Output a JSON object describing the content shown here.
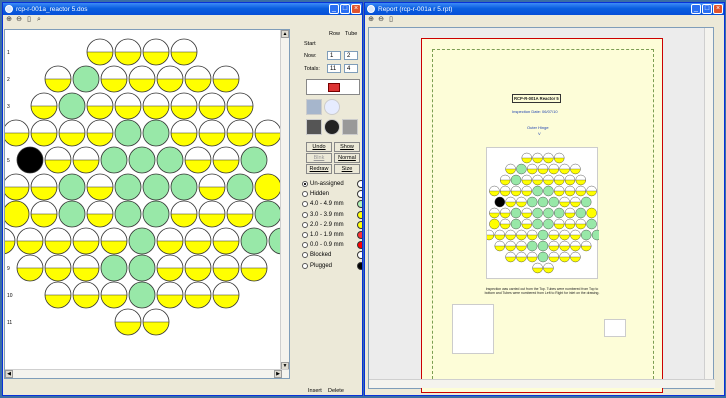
{
  "left_window": {
    "title": "rcp-r-001a_reactor 5.dos",
    "tools": [
      "zoom-in-icon",
      "zoom-out-icon",
      "page-icon",
      "magnify-icon"
    ],
    "controls": {
      "row_header": "Row",
      "tube_header": "Tube",
      "start_label": "Start",
      "now_label": "Now:",
      "now_row": "1",
      "now_tube": "2",
      "totals_label": "Totals:",
      "total_row": "11",
      "total_tube": "4"
    },
    "buttons": {
      "undo": "Undo",
      "blank": "Blnk",
      "show": "Show",
      "normal": "Normal",
      "redraw": "Redraw",
      "size": "Size"
    },
    "legend": [
      {
        "label": "Un-assigned",
        "color": "#ffffff",
        "checked": true
      },
      {
        "label": "Hidden",
        "color": "#ffffff",
        "checked": false
      },
      {
        "label": "4.0 - 4.9 mm",
        "color": "#b0f0b8",
        "checked": false
      },
      {
        "label": "3.0 - 3.9 mm",
        "color": "#ffff00",
        "checked": false
      },
      {
        "label": "2.0 - 2.9 mm",
        "color": "#ffff00",
        "checked": false
      },
      {
        "label": "1.0 - 1.9 mm",
        "color": "#ff3333",
        "checked": false
      },
      {
        "label": "0.0 - 0.9 mm",
        "color": "#ff0000",
        "checked": false
      },
      {
        "label": "Blocked",
        "color": "#ffffff",
        "checked": false
      },
      {
        "label": "Plugged",
        "color": "#000000",
        "checked": false
      }
    ],
    "row_numbers": [
      "1",
      "2",
      "3",
      "4",
      "5",
      "6",
      "7",
      "8",
      "9",
      "10",
      "11"
    ],
    "status_bar": [
      "Insert",
      "Delete"
    ],
    "tubes": [
      [
        "H",
        "H",
        "H",
        "H"
      ],
      [
        "H",
        "G",
        "H",
        "H",
        "H",
        "H",
        "H"
      ],
      [
        "H",
        "G",
        "H",
        "H",
        "H",
        "H",
        "H",
        "H"
      ],
      [
        "H",
        "H",
        "H",
        "H",
        "G",
        "G",
        "H",
        "H",
        "H",
        "H"
      ],
      [
        "B",
        "H",
        "H",
        "G",
        "G",
        "G",
        "H",
        "H",
        "G"
      ],
      [
        "H",
        "H",
        "G",
        "H",
        "G",
        "G",
        "G",
        "H",
        "G",
        "Y"
      ],
      [
        "Y",
        "H",
        "G",
        "H",
        "G",
        "G",
        "H",
        "H",
        "H",
        "G"
      ],
      [
        "H",
        "H",
        "H",
        "H",
        "H",
        "G",
        "H",
        "H",
        "H",
        "G",
        "G"
      ],
      [
        "H",
        "H",
        "H",
        "G",
        "G",
        "H",
        "H",
        "H",
        "H"
      ],
      [
        "H",
        "H",
        "H",
        "G",
        "H",
        "H",
        "H"
      ],
      [
        "H",
        "H"
      ]
    ]
  },
  "right_window": {
    "title": "Report (rcp-r-001a r 5.rpt)",
    "tools": [
      "zoom-in-icon",
      "zoom-out-icon",
      "page-icon"
    ],
    "report": {
      "heading": "RCP-R-001A Reactor 5",
      "date": "Inspection Date: 06/07/10",
      "side": "Outer Hinge",
      "side_letter": "V",
      "note": "Inspection was carried out from the Top. Tubes were numbered from Top to bottom and Tubes were numbered from Left to Right for inlet on the drawing."
    }
  },
  "colors": {
    "yellow": "#ffff00",
    "green": "#98e8a8",
    "black": "#000000",
    "outline": "#333333"
  }
}
